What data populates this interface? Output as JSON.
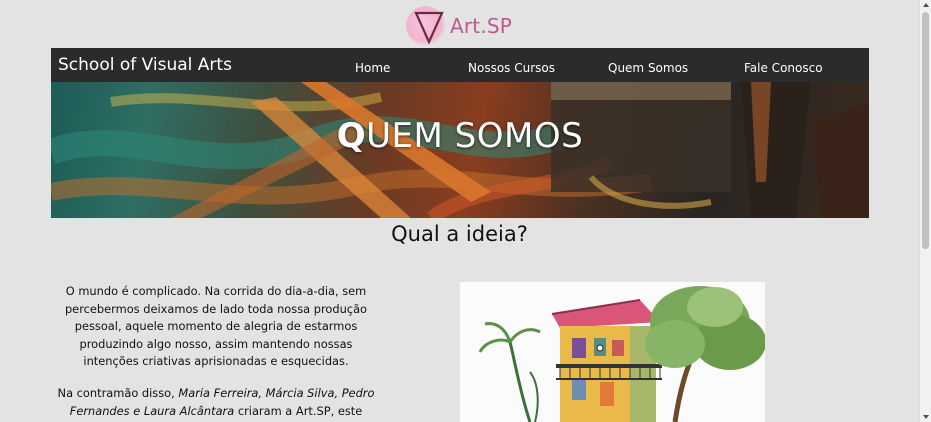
{
  "logo": {
    "brand": "Art.SP",
    "icon": "inverted-triangle-logo-icon",
    "color": "#c0578f"
  },
  "header": {
    "site_title": "School of Visual Arts"
  },
  "nav": {
    "items": [
      "Home",
      "Nossos Cursos",
      "Quem Somos",
      "Fale Conosco"
    ]
  },
  "hero": {
    "title_first": "Q",
    "title_rest": "UEM SOMOS"
  },
  "section": {
    "title": "Qual a ideia?"
  },
  "paragraph1": "O mundo é complicado. Na corrida do dia-a-dia, sem percebermos deixamos de lado toda nossa produção pessoal, aquele momento de alegria de estarmos produzindo algo nosso, assim mantendo nossas intenções criativas aprisionadas e esquecidas.",
  "paragraph2": {
    "before": "Na contramão disso, ",
    "names": "Maria Ferreira, Márcia Silva, Pedro Fernandes e Laura Alcântara",
    "after": " criaram a Art.SP, este espaço"
  },
  "colors": {
    "navbar": "#2b2b2b",
    "background": "#e3e3e3",
    "accent": "#c0578f"
  }
}
